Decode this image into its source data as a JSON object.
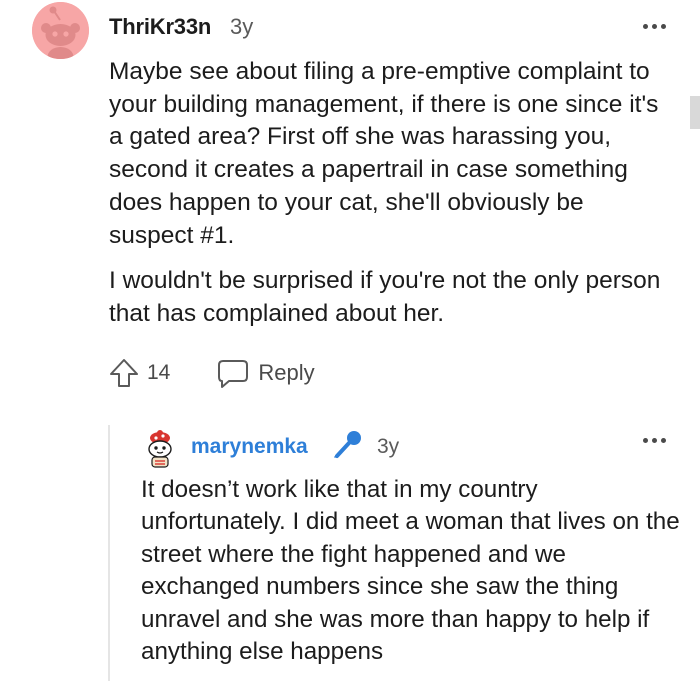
{
  "top_comment": {
    "username": "ThriKr33n",
    "age": "3y",
    "paragraphs": [
      "Maybe see about filing a pre-emptive complaint to your building management, if there is one since it's a gated area? First off she was harassing you, second it creates a papertrail in case something does happen to your cat, she'll obviously be suspect #1.",
      "I wouldn't be surprised if you're not the only person that has complained about her."
    ],
    "upvote_count": "14",
    "reply_label": "Reply",
    "avatar_color": "#f7a6a6"
  },
  "reply_comment": {
    "username": "marynemka",
    "age": "3y",
    "text": "It doesn’t work like that in my country unfortunately. I did meet a woman that lives on the street where the fight happened and we exchanged numbers since she saw the thing unravel and she was more than happy to help if anything else happens",
    "username_color": "#2e7fd8"
  },
  "icons": {
    "more": "more-options-icon",
    "upvote": "upvote-arrow-icon",
    "reply": "speech-bubble-icon",
    "op": "microphone-icon"
  }
}
